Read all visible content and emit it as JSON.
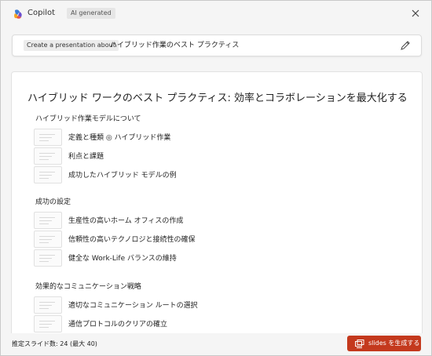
{
  "header": {
    "app_name": "Copilot",
    "badge": "AI generated",
    "brand_colors": [
      "#e8534a",
      "#f5a623",
      "#3a7bd5",
      "#6a4fd0"
    ]
  },
  "prompt": {
    "chip": "Create a presentation about",
    "text": "ハイブリッド作業のベスト プラクティス"
  },
  "outline": {
    "title": "ハイブリッド ワークのベスト プラクティス: 効率とコラボレーションを最大化する",
    "sections": [
      {
        "heading": "ハイブリッド作業モデルについて",
        "slides": [
          "定義と種類 ◎ ハイブリッド作業",
          "利点と課題",
          "成功したハイブリッド モデルの例"
        ]
      },
      {
        "heading": "成功の設定",
        "slides": [
          "生産性の高いホーム オフィスの作成",
          "信頼性の高いテクノロジと接続性の確保",
          "健全な Work-Life バランスの維持"
        ]
      },
      {
        "heading": "効果的なコミュニケーション戦略",
        "slides": [
          "適切なコミュニケーション ルートの選択",
          "通信プロトコルのクリアの確立"
        ]
      }
    ]
  },
  "footer": {
    "estimate": "推定スライド数: 24 (最大 40)",
    "generate_label": "slides を生成する",
    "accent": "#c4391d"
  }
}
